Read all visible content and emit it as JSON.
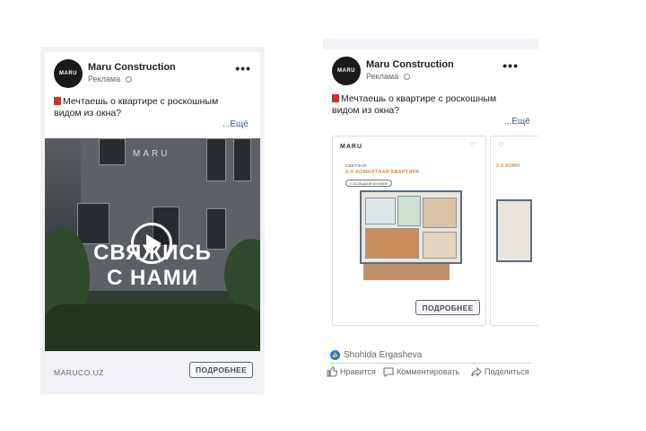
{
  "ad_left": {
    "page_name": "Maru Construction",
    "sponsored": "Реклама",
    "avatar_text": "MARU",
    "more": "•••",
    "text": "Мечтаешь о квартире с роскошным видом из окна?",
    "see_more": "...Ещё",
    "video": {
      "watermark": "MARU",
      "headline_line1": "СВЯЖИСЬ",
      "headline_line2": "С НАМИ"
    },
    "domain": "MARUCO.UZ",
    "cta": "ПОДРОБНЕЕ"
  },
  "ad_right": {
    "page_name": "Maru Construction",
    "sponsored": "Реклама",
    "avatar_text": "MARU",
    "more": "•••",
    "text": "Мечтаешь о квартире с роскошным видом из окна?",
    "see_more": "...Ещё",
    "carousel": [
      {
        "brand": "MARU",
        "small": "СВЕТЛАЯ",
        "title": "2-Х КОМНАТНАЯ КВАРТИРА",
        "pill": "С БОЛЬШОЙ КУХНЕЙ",
        "cta": "ПОДРОБНЕЕ"
      },
      {
        "small": "2-Х КОМН"
      }
    ],
    "reaction_name": "Shohida Ergasheva",
    "actions": {
      "like": "Нравится",
      "comment": "Комментировать",
      "share": "Поделиться"
    }
  },
  "colors": {
    "link": "#385898",
    "accent_orange": "#d38a4a",
    "like_blue": "#1877f2"
  }
}
